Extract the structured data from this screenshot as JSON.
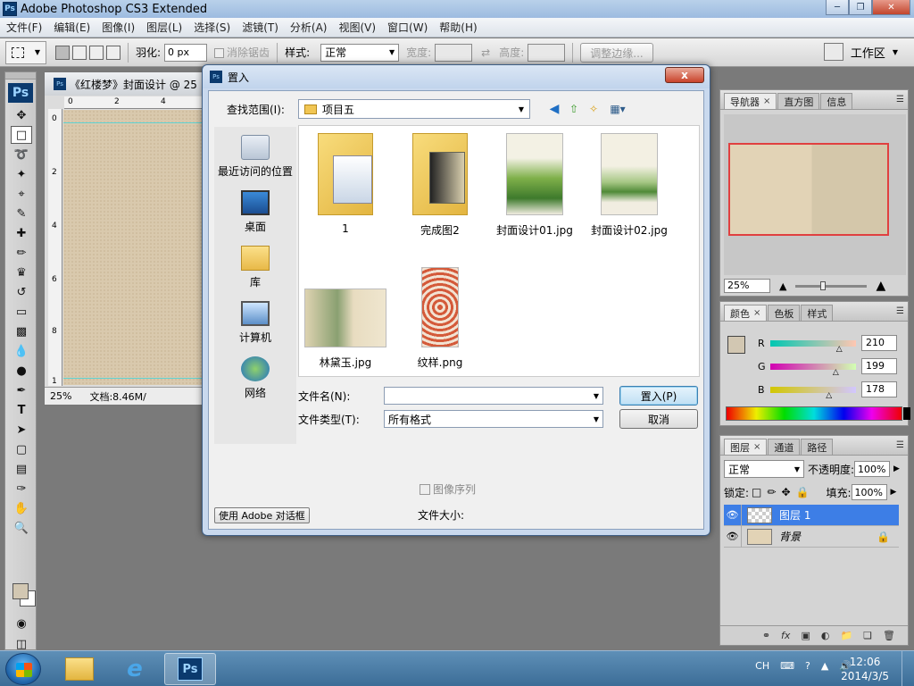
{
  "app": {
    "title": "Adobe Photoshop CS3 Extended",
    "logo": "Ps"
  },
  "menu": [
    "文件(F)",
    "编辑(E)",
    "图像(I)",
    "图层(L)",
    "选择(S)",
    "滤镜(T)",
    "分析(A)",
    "视图(V)",
    "窗口(W)",
    "帮助(H)"
  ],
  "options": {
    "feather_label": "羽化:",
    "feather_value": "0 px",
    "antialias_label": "消除锯齿",
    "style_label": "样式:",
    "style_value": "正常",
    "width_label": "宽度:",
    "height_label": "高度:",
    "refine_edge": "调整边缘...",
    "workspace": "工作区"
  },
  "document": {
    "tab_title": "《红楼梦》封面设计 @ 25",
    "ruler_h": [
      "0",
      "2",
      "4"
    ],
    "ruler_v": [
      "0",
      "2",
      "4",
      "6",
      "8",
      "1"
    ],
    "zoom": "25%",
    "doc_size": "文档:8.46M/"
  },
  "navigator": {
    "tabs": [
      "导航器",
      "直方图",
      "信息"
    ],
    "zoom": "25%"
  },
  "color_panel": {
    "tabs": [
      "颜色",
      "色板",
      "样式"
    ],
    "r_label": "R",
    "g_label": "G",
    "b_label": "B",
    "r": "210",
    "g": "199",
    "b": "178",
    "r_level": 0.82,
    "g_level": 0.78,
    "b_level": 0.7,
    "fg_color": "#d2c7b2"
  },
  "layers_panel": {
    "tabs": [
      "图层",
      "通道",
      "路径"
    ],
    "blend_mode": "正常",
    "opacity_label": "不透明度:",
    "opacity": "100%",
    "lock_label": "锁定:",
    "fill_label": "填充:",
    "fill": "100%",
    "layers": [
      {
        "name": "图层 1",
        "selected": true
      },
      {
        "name": "背景",
        "selected": false
      }
    ]
  },
  "dialog": {
    "title": "置入",
    "close_glyph": "x",
    "look_in_label": "查找范围(I):",
    "look_in_value": "项目五",
    "places": [
      "最近访问的位置",
      "桌面",
      "库",
      "计算机",
      "网络"
    ],
    "files": [
      "1",
      "完成图2",
      "封面设计01.jpg",
      "封面设计02.jpg",
      "林黛玉.jpg",
      "纹样.png"
    ],
    "filename_label": "文件名(N):",
    "filename_value": "",
    "filetype_label": "文件类型(T):",
    "filetype_value": "所有格式",
    "place_button": "置入(P)",
    "cancel_button": "取消",
    "image_sequence": "图像序列",
    "file_size_label": "文件大小:",
    "adobe_dialog_button": "使用 Adobe 对话框"
  },
  "taskbar": {
    "lang": "CH",
    "time": "12:06",
    "date": "2014/3/5",
    "ps_label": "Ps"
  }
}
